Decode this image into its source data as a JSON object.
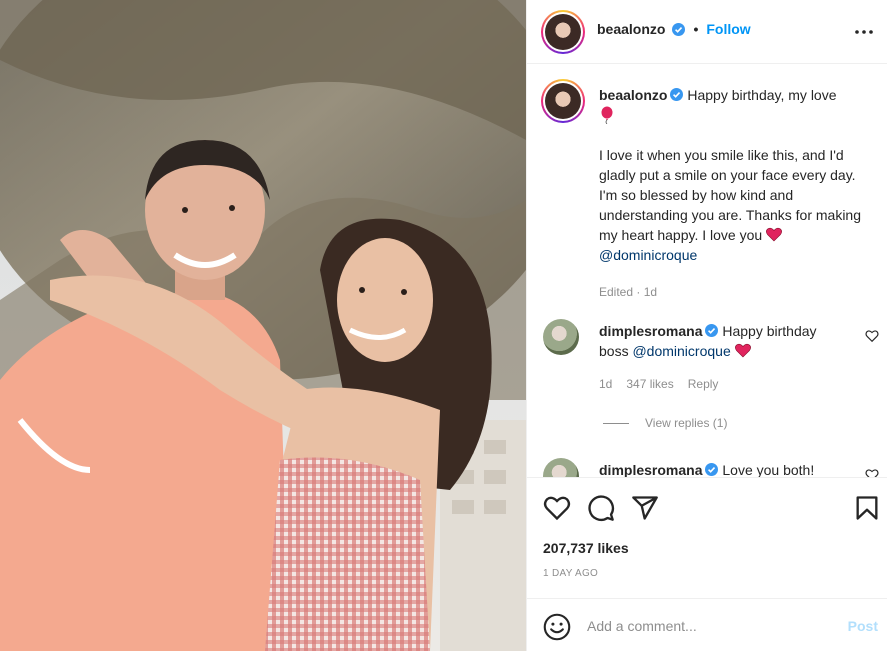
{
  "header": {
    "username": "beaalonzo",
    "separator": "•",
    "follow_label": "Follow",
    "more_icon": "more-horizontal-icon"
  },
  "caption": {
    "username": "beaalonzo",
    "line1": "Happy birthday, my love",
    "paragraph": "I love it when you smile like this, and I'd gladly put a smile on your face every day. I'm so blessed by how kind and understanding you are. Thanks for making my heart happy. I love you",
    "mention": "@dominicroque",
    "meta": "Edited · 1d"
  },
  "comments": [
    {
      "username": "dimplesromana",
      "text": "Happy birthday boss",
      "mention": "@dominicroque",
      "time": "1d",
      "likes": "347 likes",
      "reply": "Reply",
      "view_replies": "View replies (1)"
    },
    {
      "username": "dimplesromana",
      "text": "Love you both!"
    }
  ],
  "actions": {
    "likes": "207,737 likes",
    "time": "1 DAY AGO"
  },
  "add_comment": {
    "placeholder": "Add a comment...",
    "post_label": "Post"
  },
  "colors": {
    "link": "#0095f6",
    "mention": "#00376b",
    "muted": "#8e8e8e",
    "heart": "#e0245e"
  }
}
